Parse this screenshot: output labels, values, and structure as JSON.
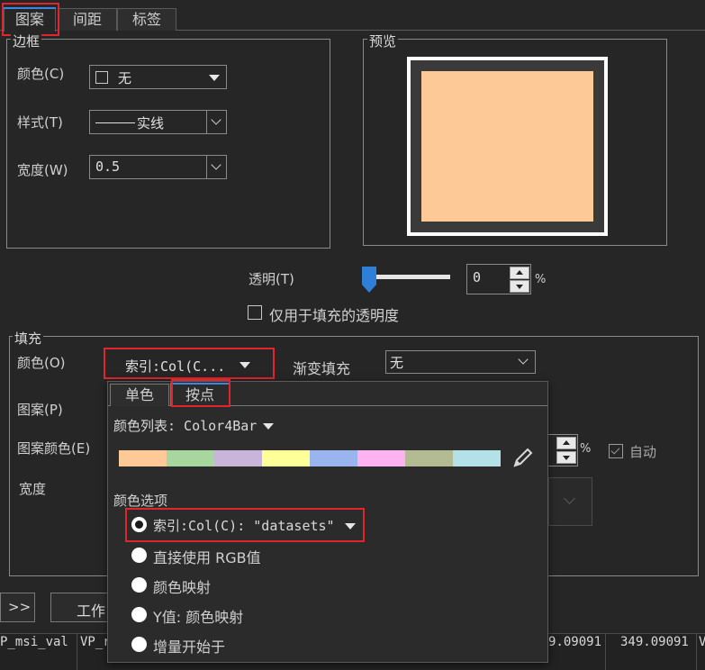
{
  "tabs": [
    "图案",
    "间距",
    "标签"
  ],
  "border": {
    "legend": "边框",
    "color_label": "颜色(C)",
    "color_value": "无",
    "style_label": "样式(T)",
    "style_value": "实线",
    "width_label": "宽度(W)",
    "width_value": "0.5"
  },
  "preview": {
    "legend": "预览",
    "fill_color": "#fdc996"
  },
  "transparency": {
    "label": "透明(T)",
    "value": "0",
    "unit": "%",
    "slider_fraction": 0,
    "checkbox_label": "仅用于填充的透明度"
  },
  "fill": {
    "legend": "填充",
    "color_label": "颜色(O)",
    "color_value": "索引:Col(C...",
    "gradient_label": "渐变填充",
    "gradient_value": "无",
    "pattern_label": "图案(P)",
    "pattern_color_label": "图案颜色(E)",
    "pattern_percent_unit": "%",
    "auto_label": "自动",
    "width_label": "宽度"
  },
  "popup": {
    "tabs": [
      "单色",
      "按点"
    ],
    "color_list_label": "颜色列表: Color4Bar",
    "swatches": [
      "#fdc996",
      "#a8d69f",
      "#c9b4da",
      "#ffff99",
      "#99b4ef",
      "#ffb2f2",
      "#b3bb92",
      "#b4e1e8"
    ],
    "options_title": "颜色选项",
    "options": [
      "索引:Col(C): \"datasets\"",
      "直接使用 RGB值",
      "颜色映射",
      "Y值: 颜色映射",
      "增量开始于"
    ],
    "selected_option": 0
  },
  "bottom": {
    "expand_button": ">>",
    "work_button": "工作",
    "cells": [
      "P_msi_val",
      "VP_r",
      "9.09091",
      "349.09091",
      "V"
    ]
  }
}
